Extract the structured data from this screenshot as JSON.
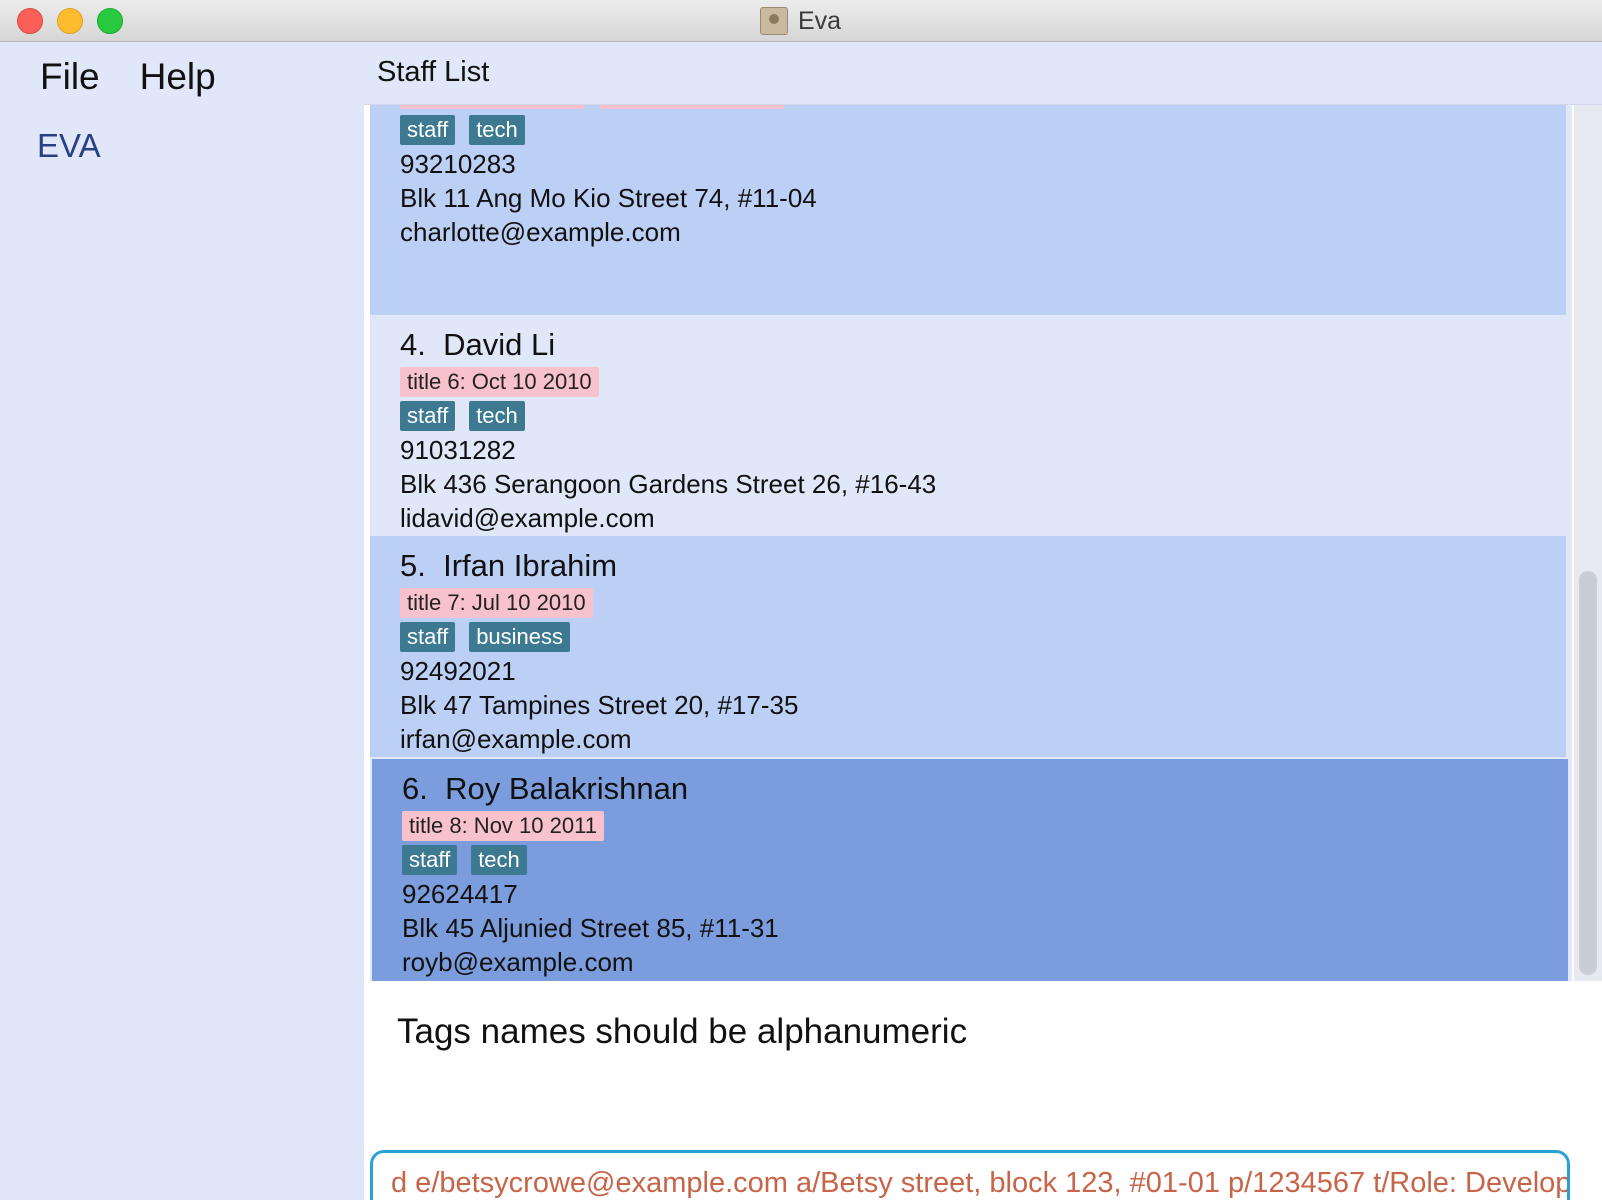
{
  "window": {
    "title": "Eva"
  },
  "menu": {
    "file": "File",
    "help": "Help"
  },
  "sidebar": {
    "label": "EVA"
  },
  "list": {
    "header": "Staff List",
    "partial": {
      "tags": [
        "staff",
        "tech"
      ],
      "phone": "93210283",
      "address": "Blk 11 Ang Mo Kio Street 74, #11-04",
      "email": "charlotte@example.com"
    },
    "items": [
      {
        "index": "4.",
        "name": "David Li",
        "title": "title 6: Oct 10 2010",
        "tags": [
          "staff",
          "tech"
        ],
        "phone": "91031282",
        "address": "Blk 436 Serangoon Gardens Street 26, #16-43",
        "email": "lidavid@example.com"
      },
      {
        "index": "5.",
        "name": "Irfan Ibrahim",
        "title": "title 7: Jul 10 2010",
        "tags": [
          "staff",
          "business"
        ],
        "phone": "92492021",
        "address": "Blk 47 Tampines Street 20, #17-35",
        "email": "irfan@example.com"
      },
      {
        "index": "6.",
        "name": "Roy Balakrishnan",
        "title": "title 8: Nov 10 2011",
        "tags": [
          "staff",
          "tech"
        ],
        "phone": "92624417",
        "address": "Blk 45 Aljunied Street 85, #11-31",
        "email": "royb@example.com"
      }
    ]
  },
  "result": {
    "message": "Tags names should be alphanumeric"
  },
  "command": {
    "value": "d e/betsycrowe@example.com a/Betsy street, block 123, #01-01 p/1234567 t/Role: Developer"
  },
  "colors": {
    "card_light": "#e0e7f8",
    "card_mid": "#bccff5",
    "card_selected": "#7c9ddd",
    "tag": "#3d7a92",
    "title_badge": "#f8c2cc",
    "command_text": "#c86448",
    "command_border": "#2aa1d6"
  }
}
